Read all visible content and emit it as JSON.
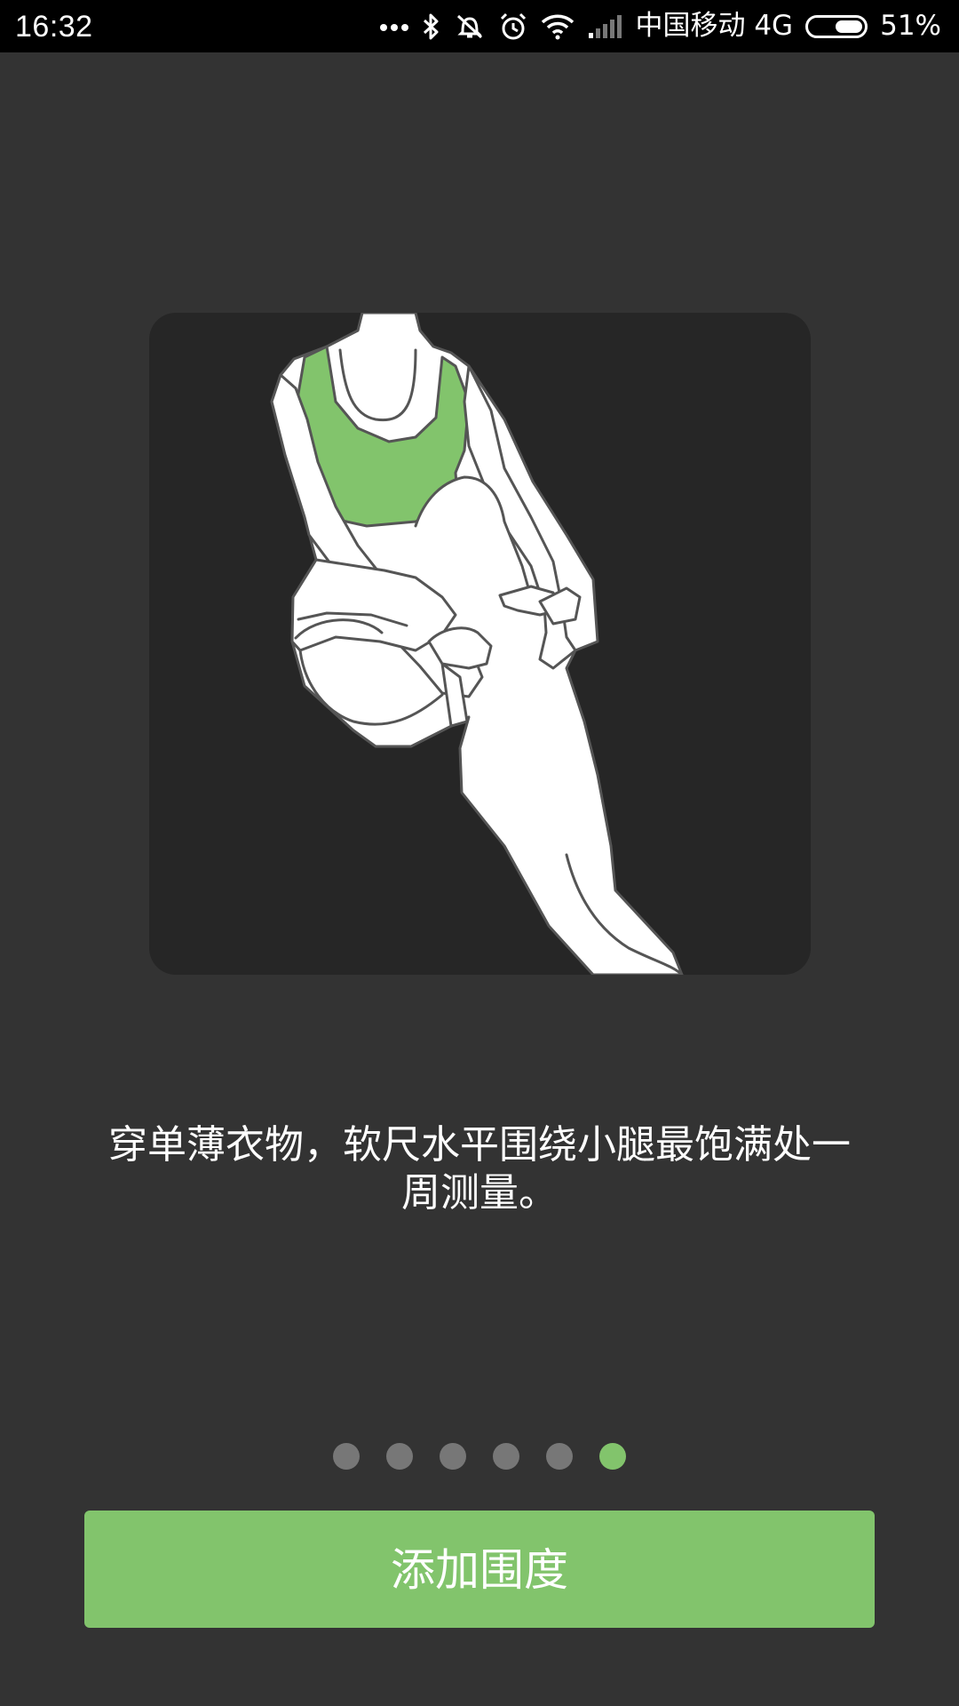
{
  "status_bar": {
    "time": "16:32",
    "carrier": "中国移动 4G",
    "battery_percent": "51%",
    "battery_level": 0.51,
    "icons": [
      "more-dots-icon",
      "bluetooth-icon",
      "vibrate-off-icon",
      "alarm-icon",
      "wifi-icon",
      "signal-icon",
      "battery-icon"
    ]
  },
  "illustration": {
    "icon": "calf-measurement-illustration",
    "accent_color": "#82c46c"
  },
  "instruction": {
    "text": "穿单薄衣物，软尺水平围绕小腿最饱满处一周测量。"
  },
  "pagination": {
    "total": 6,
    "current": 6,
    "active_color": "#82c46c",
    "inactive_color": "#777777"
  },
  "primary_action": {
    "label": "添加围度",
    "color": "#82c46c"
  }
}
